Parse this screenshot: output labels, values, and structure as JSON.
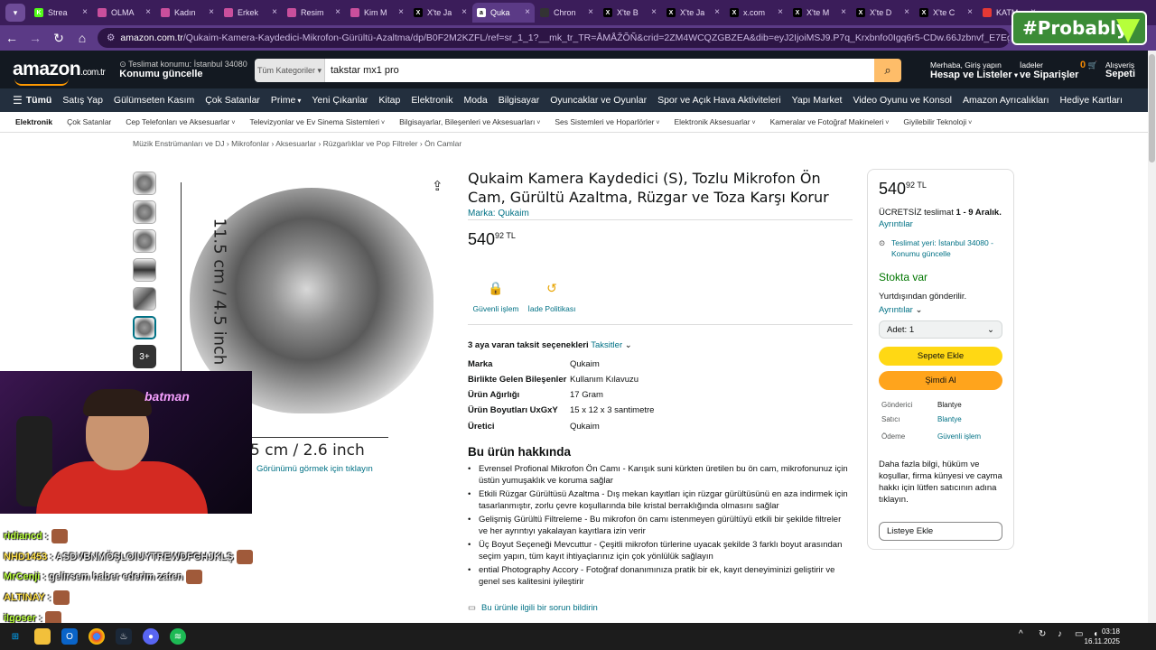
{
  "browser": {
    "tabs": [
      {
        "label": "Strea",
        "fav_color": "#53fc18",
        "fav": "K"
      },
      {
        "label": "OLMA",
        "fav_color": "#c94f9c",
        "fav": ""
      },
      {
        "label": "Kadın",
        "fav_color": "#c94f9c",
        "fav": ""
      },
      {
        "label": "Erkek",
        "fav_color": "#c94f9c",
        "fav": ""
      },
      {
        "label": "Resim",
        "fav_color": "#c94f9c",
        "fav": ""
      },
      {
        "label": "Kim M",
        "fav_color": "#c94f9c",
        "fav": ""
      },
      {
        "label": "X'te Ja",
        "fav_color": "#000000",
        "fav": "X"
      },
      {
        "label": "Quka",
        "fav_color": "#ffffff",
        "fav": "a",
        "active": true
      },
      {
        "label": "Chron",
        "fav_color": "#333333",
        "fav": ""
      },
      {
        "label": "X'te B",
        "fav_color": "#000000",
        "fav": "X"
      },
      {
        "label": "X'te Ja",
        "fav_color": "#000000",
        "fav": "X"
      },
      {
        "label": "x.com",
        "fav_color": "#000000",
        "fav": "X"
      },
      {
        "label": "X'te M",
        "fav_color": "#000000",
        "fav": "X"
      },
      {
        "label": "X'te D",
        "fav_color": "#000000",
        "fav": "X"
      },
      {
        "label": "X'te C",
        "fav_color": "#000000",
        "fav": "X"
      },
      {
        "label": "KATM",
        "fav_color": "#e53935",
        "fav": ""
      }
    ],
    "url_domain": "amazon.com.tr",
    "url_rest": "/Qukaim-Kamera-Kaydedici-Mikrofon-Gürültü-Azaltma/dp/B0F2M2KZFL/ref=sr_1_1?__mk_tr_TR=ÅMÅŽÕÑ&crid=2ZM4WCQZGBZEA&dib=eyJ2IjoiMSJ9.P7q_Krxbnfo0Igq6r5-CDw.66Jzbnvf_E7EgJmSq7QhgyIxN82yzqGYWI9VufY_QSE&dib",
    "overlay_tag": "#Probably"
  },
  "header": {
    "logo": "amazon",
    "logo_suffix": ".com.tr",
    "deliver_line1": "Teslimat konumu: İstanbul 34080",
    "deliver_line2": "Konumu güncelle",
    "search_category": "Tüm Kategoriler",
    "search_value": "takstar mx1 pro",
    "account_line1": "Merhaba, Giriş yapın",
    "account_line2": "Hesap ve Listeler",
    "orders_line1": "İadeler",
    "orders_line2": "ve Siparişler",
    "cart_count": "0",
    "cart_line1": "Alışveriş",
    "cart_line2": "Sepeti"
  },
  "nav": [
    "Tümü",
    "Satış Yap",
    "Gülümseten Kasım",
    "Çok Satanlar",
    "Prime",
    "Yeni Çıkanlar",
    "Kitap",
    "Elektronik",
    "Moda",
    "Bilgisayar",
    "Oyuncaklar ve Oyunlar",
    "Spor ve Açık Hava Aktiviteleri",
    "Yapı Market",
    "Video Oyunu ve Konsol",
    "Amazon Ayrıcalıkları",
    "Hediye Kartları"
  ],
  "subnav": [
    "Elektronik",
    "Çok Satanlar",
    "Cep Telefonları ve Aksesuarlar",
    "Televizyonlar ve Ev Sinema Sistemleri",
    "Bilgisayarlar, Bileşenleri ve Aksesuarları",
    "Ses Sistemleri ve Hoparlörler",
    "Elektronik Aksesuarlar",
    "Kameralar ve Fotoğraf Makineleri",
    "Giyilebilir Teknoloji"
  ],
  "breadcrumb": "Müzik Enstrümanları ve DJ › Mikrofonlar › Aksesuarlar › Rüzgarlıklar ve Pop Filtreler › Ön Camlar",
  "gallery": {
    "more_label": "3+",
    "vertical_dim": "11.5 cm / 4.5 inch",
    "horizontal_dim": "5 cm / 2.6 inch",
    "zoom_hint": "Görünümü görmek için tıklayın"
  },
  "product": {
    "title": "Qukaim Kamera Kaydedici (S), Tozlu Mikrofon Ön Cam, Gürültü Azaltma, Rüzgar ve Toza Karşı Korur",
    "brand": "Marka: Qukaim",
    "price_whole": "540",
    "price_fraction": "92 TL",
    "badge_secure": "Güvenli işlem",
    "badge_return": "İade Politikası",
    "installment_label": "3 aya varan taksit seçenekleri",
    "installment_link": "Taksitler",
    "specs": [
      {
        "k": "Marka",
        "v": "Qukaim"
      },
      {
        "k": "Birlikte Gelen Bileşenler",
        "v": "Kullanım Kılavuzu"
      },
      {
        "k": "Ürün Ağırlığı",
        "v": "17 Gram"
      },
      {
        "k": "Ürün Boyutları UxGxY",
        "v": "15 x 12 x 3 santimetre"
      },
      {
        "k": "Üretici",
        "v": "Qukaim"
      }
    ],
    "about_heading": "Bu ürün hakkında",
    "bullets": [
      "Evrensel Profional Mikrofon Ön Camı - Karışık suni kürkten üretilen bu ön cam, mikrofonunuz için üstün yumuşaklık ve koruma sağlar",
      "Etkili Rüzgar Gürültüsü Azaltma - Dış mekan kayıtları için rüzgar gürültüsünü en aza indirmek için tasarlanmıştır, zorlu çevre koşullarında bile kristal berraklığında olmasını sağlar",
      "Gelişmiş Gürültü Filtreleme - Bu mikrofon ön camı istenmeyen gürültüyü etkili bir şekilde filtreler ve her ayrıntıyı yakalayan kayıtlara izin verir",
      "Üç Boyut Seçeneği Mevcuttur - Çeşitli mikrofon türlerine uyacak şekilde 3 farklı boyut arasından seçim yapın, tüm kayıt ihtiyaçlarınız için çok yönlülük sağlayın",
      "ential Photography Accory - Fotoğraf donanımınıza pratik bir ek, kayıt deneyiminizi geliştirir ve genel ses kalitesini iyileştirir"
    ],
    "report_link": "Bu ürünle ilgili bir sorun bildirin"
  },
  "buybox": {
    "price_whole": "540",
    "price_fraction": "92 TL",
    "shipping": "ÜCRETSİZ teslimat",
    "shipping_dates": "1 - 9 Aralık.",
    "details": "Ayrıntılar",
    "location": "Teslimat yeri: İstanbul 34080 - Konumu güncelle",
    "stock": "Stokta var",
    "abroad": "Yurtdışından gönderilir.",
    "details2": "Ayrıntılar",
    "qty_label": "Adet: 1",
    "add_to_cart": "Sepete Ekle",
    "buy_now": "Şimdi Al",
    "rows": [
      {
        "k": "Gönderici",
        "v": "Blantye"
      },
      {
        "k": "Satıcı",
        "v": "Blantye"
      },
      {
        "k": "Ödeme",
        "v": "Güvenli işlem"
      }
    ],
    "info": "Daha fazla bilgi, hüküm ve koşullar, firma künyesi ve cayma hakkı için lütfen satıcının adına tıklayın.",
    "add_list": "Listeye Ekle"
  },
  "stream": {
    "neon": "batman",
    "chat": [
      {
        "user": "ridiancd",
        "msg": ""
      },
      {
        "user": "NHD1453",
        "msg": "ASDVBNMÖŞLOIUYTREWDFGHJKLŞ"
      },
      {
        "user": "MrCenji",
        "msg": "gelirsem haber ederim zaten"
      },
      {
        "user": "ALTINAY",
        "msg": ""
      },
      {
        "user": "ilgoser",
        "msg": ""
      }
    ]
  },
  "taskbar": {
    "time": "03:18",
    "date": "16.11.2025"
  }
}
